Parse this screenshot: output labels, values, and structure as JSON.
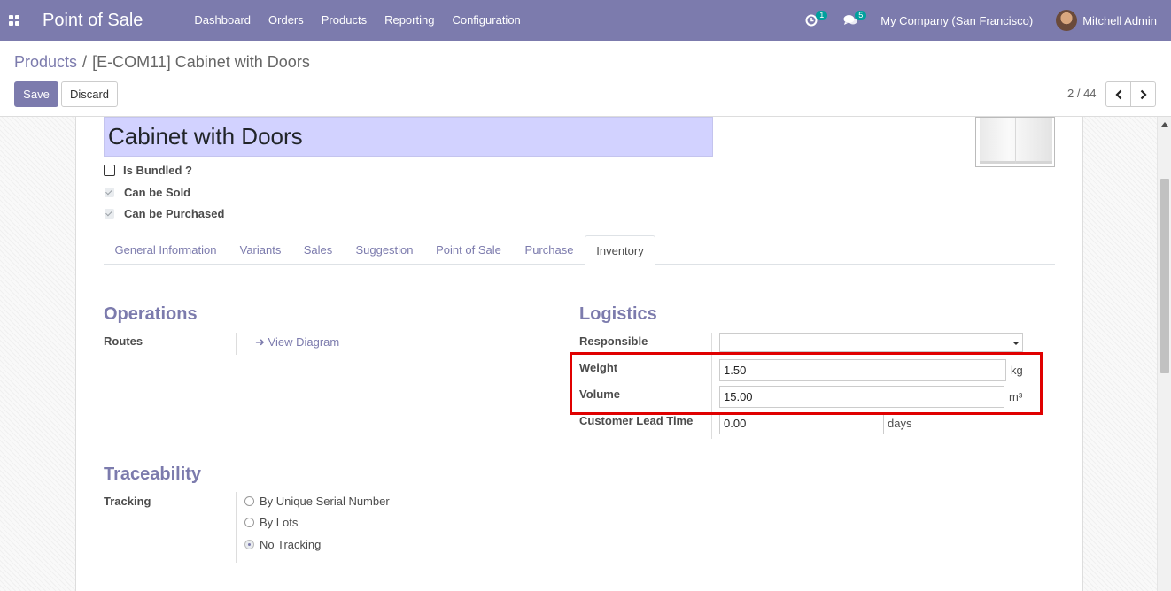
{
  "navbar": {
    "app_title": "Point of Sale",
    "menu": [
      "Dashboard",
      "Orders",
      "Products",
      "Reporting",
      "Configuration"
    ],
    "activity_count": "1",
    "message_count": "5",
    "company": "My Company (San Francisco)",
    "user": "Mitchell Admin"
  },
  "breadcrumb": {
    "parent": "Products",
    "separator": "/",
    "current": "[E-COM11] Cabinet with Doors"
  },
  "actions": {
    "save_label": "Save",
    "discard_label": "Discard"
  },
  "pager": {
    "value": "2 / 44"
  },
  "product": {
    "name": "Cabinet with Doors",
    "options": [
      {
        "label": "Is Bundled ?",
        "checked": false
      },
      {
        "label": "Can be Sold",
        "checked": true
      },
      {
        "label": "Can be Purchased",
        "checked": true
      }
    ]
  },
  "tabs": [
    "General Information",
    "Variants",
    "Sales",
    "Suggestion",
    "Point of Sale",
    "Purchase",
    "Inventory"
  ],
  "active_tab": "Inventory",
  "operations": {
    "title": "Operations",
    "routes_label": "Routes",
    "view_diagram": "View Diagram"
  },
  "logistics": {
    "title": "Logistics",
    "responsible_label": "Responsible",
    "responsible_value": "",
    "weight_label": "Weight",
    "weight_value": "1.50",
    "weight_unit": "kg",
    "volume_label": "Volume",
    "volume_value": "15.00",
    "volume_unit": "m³",
    "lead_time_label": "Customer Lead Time",
    "lead_time_value": "0.00",
    "lead_time_unit": "days"
  },
  "traceability": {
    "title": "Traceability",
    "tracking_label": "Tracking",
    "options": [
      "By Unique Serial Number",
      "By Lots",
      "No Tracking"
    ],
    "selected": "No Tracking"
  },
  "colors": {
    "brand": "#7c7bad",
    "highlight": "#e00000",
    "badge": "#00a09d"
  }
}
